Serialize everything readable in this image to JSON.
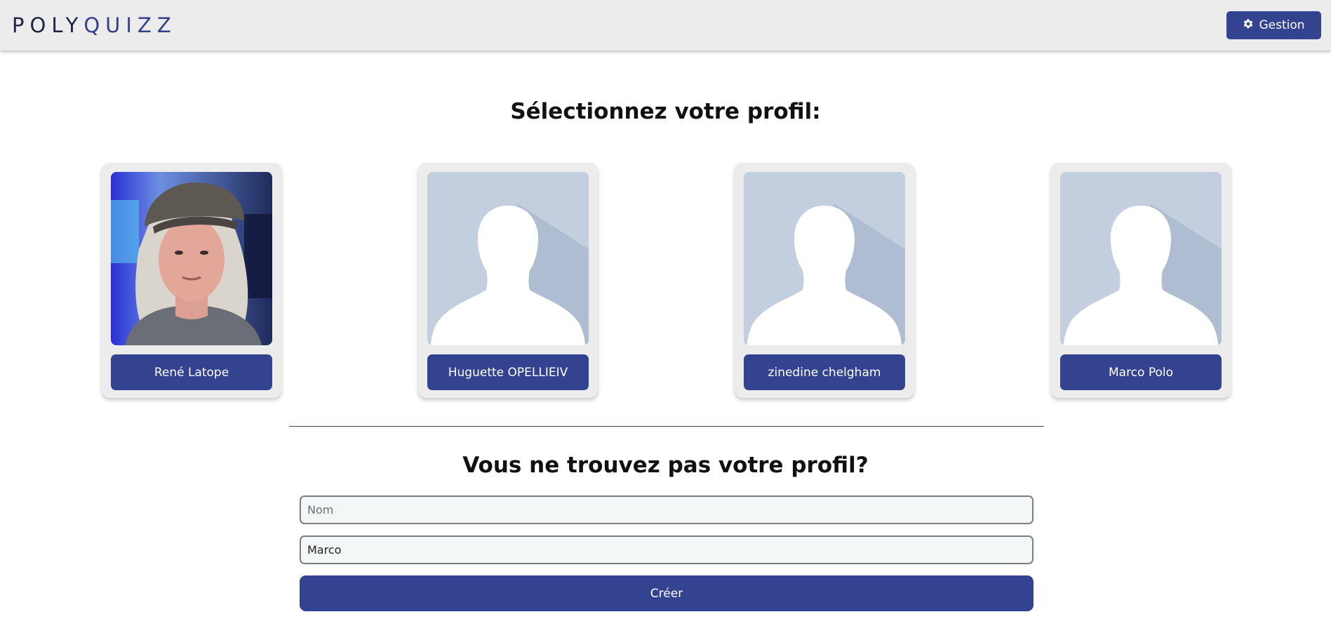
{
  "header": {
    "logo_part1": "POLY",
    "logo_part2": "QUIZZ",
    "gestion_label": "Gestion",
    "gestion_icon": "gear-icon"
  },
  "main": {
    "title": "Sélectionnez votre profil:",
    "profiles": [
      {
        "name": "René Latope",
        "avatar": "photo"
      },
      {
        "name": "Huguette OPELLIEIV",
        "avatar": "default-avatar"
      },
      {
        "name": "zinedine chelgham",
        "avatar": "default-avatar"
      },
      {
        "name": "Marco Polo",
        "avatar": "default-avatar"
      }
    ]
  },
  "create_profile": {
    "title": "Vous ne trouvez pas votre profil?",
    "nom_placeholder": "Nom",
    "nom_value": "",
    "prenom_value": "Marco",
    "submit_label": "Créer"
  },
  "colors": {
    "accent": "#33438f",
    "header_bg": "#ececec",
    "card_bg": "#ececec",
    "avatar_bg": "#c3cedf"
  }
}
